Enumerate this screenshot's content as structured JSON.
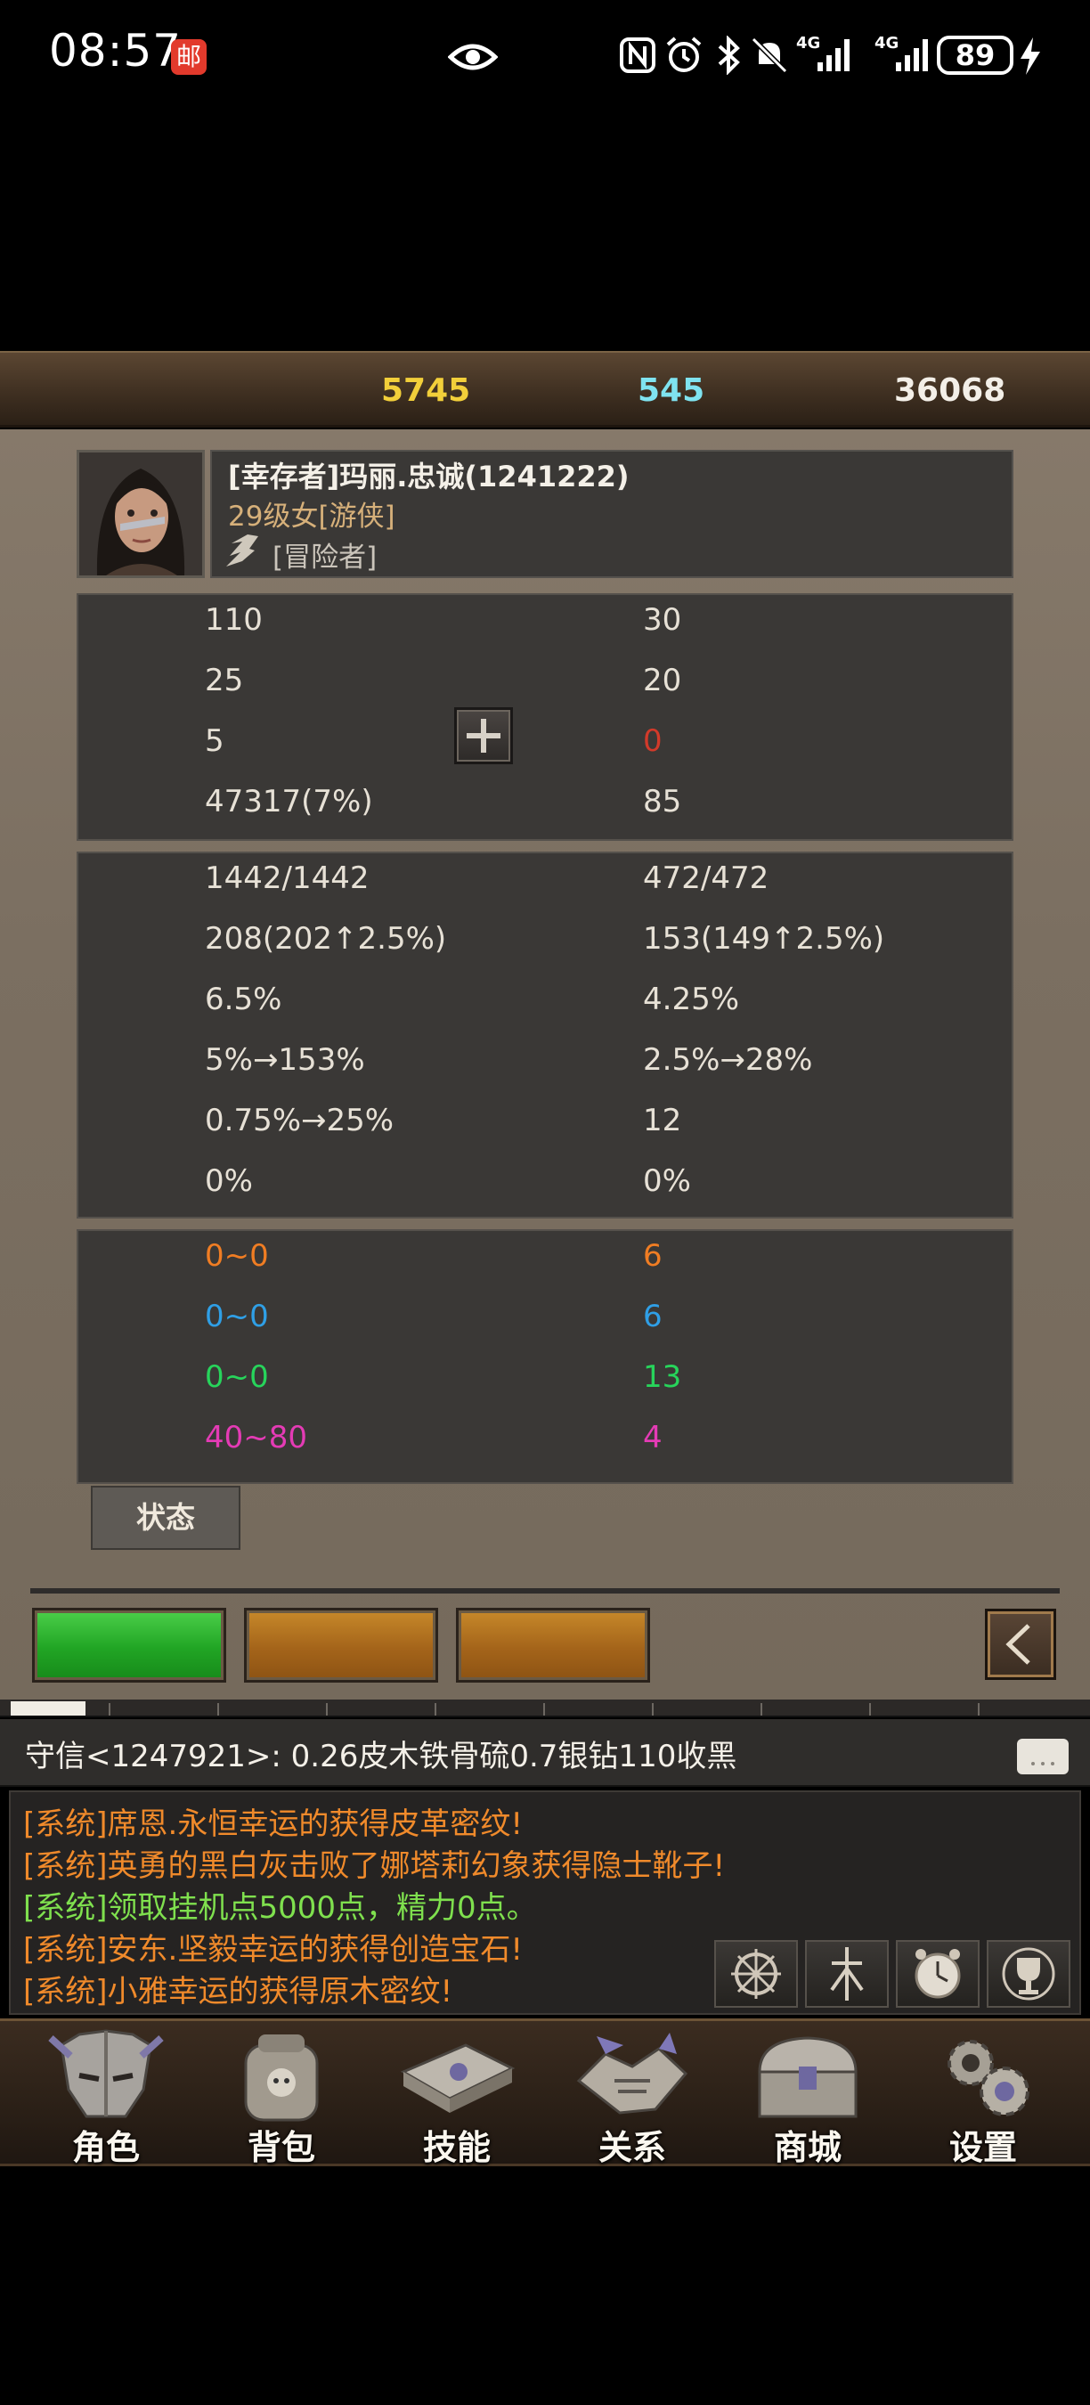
{
  "status_bar": {
    "time": "08:57",
    "mail_badge": "邮",
    "battery": "89",
    "network_1": "4G",
    "network_2": "4G"
  },
  "resources": {
    "gold": "5745",
    "diamond": "545",
    "silver": "36068"
  },
  "character": {
    "name": "[幸存者]玛丽.忠诚(1241222)",
    "level": "29级女[游侠]",
    "title": "[冒险者]"
  },
  "stats_basic": {
    "left": [
      "110",
      "25",
      "5",
      "47317(7%)"
    ],
    "right": [
      "30",
      "20",
      "0",
      "85"
    ]
  },
  "stats_combat": {
    "left": [
      "1442/1442",
      "208(202↑2.5%)",
      "6.5%",
      "5%→153%",
      "0.75%→25%",
      "0%"
    ],
    "right": [
      "472/472",
      "153(149↑2.5%)",
      "4.25%",
      "2.5%→28%",
      "12",
      "0%"
    ]
  },
  "stats_element": {
    "left": [
      "0~0",
      "0~0",
      "0~0",
      "40~80"
    ],
    "right": [
      "6",
      "6",
      "13",
      "4"
    ],
    "colors": [
      "#f07d23",
      "#2f9fe6",
      "#27d45b",
      "#e43bb5"
    ]
  },
  "state_tab": "状态",
  "chat": {
    "whisper": "守信<1247921>:  0.26皮木铁骨硫0.7银钻110收黑",
    "lines": [
      {
        "text": "[系统]席恩.永恒幸运的获得皮革密纹!",
        "type": "orange"
      },
      {
        "text": "[系统]英勇的黑白灰击败了娜塔莉幻象获得隐士靴子!",
        "type": "orange"
      },
      {
        "text": "[系统]领取挂机点5000点，精力0点。",
        "type": "green"
      },
      {
        "text": "[系统]安东.坚毅幸运的获得创造宝石!",
        "type": "orange"
      },
      {
        "text": "[系统]小雅幸运的获得原木密纹!",
        "type": "orange"
      }
    ]
  },
  "nav": [
    "角色",
    "背包",
    "技能",
    "关系",
    "商城",
    "设置"
  ],
  "colors": {
    "gold": "#f2cf3a",
    "diamond": "#7fe3f0",
    "red_value": "#d23a2a",
    "green_button": "#21a524",
    "orange_button": "#a4641a"
  }
}
